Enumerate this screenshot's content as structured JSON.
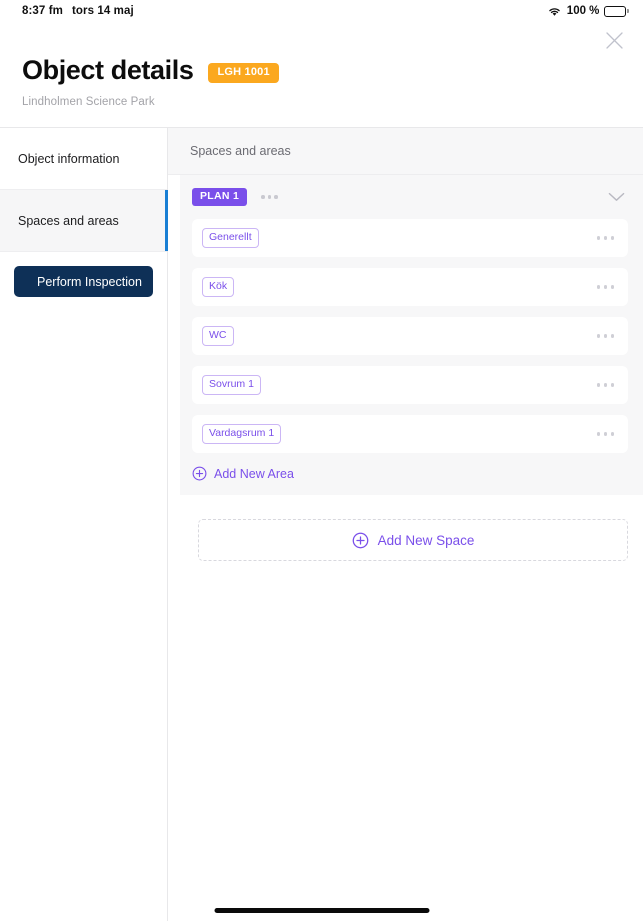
{
  "statusbar": {
    "time": "8:37 fm",
    "date": "tors 14 maj",
    "battery_percent": "100 %",
    "wifi_icon": "wifi-icon",
    "battery_icon": "battery-full-icon"
  },
  "header": {
    "close_icon": "close-icon",
    "title": "Object details",
    "object_badge": "LGH 1001",
    "subtitle": "Lindholmen Science Park"
  },
  "sidebar": {
    "items": [
      {
        "label": "Object information",
        "active": false
      },
      {
        "label": "Spaces and areas",
        "active": true
      }
    ],
    "inspect_button": {
      "label": "Perform Inspection",
      "icon": "scan-plus-icon"
    }
  },
  "main": {
    "section_title": "Spaces and areas",
    "plan": {
      "badge": "PLAN 1",
      "menu_icon": "ellipsis-icon",
      "collapse_icon": "chevron-down-icon",
      "areas": [
        {
          "label": "Generellt",
          "menu_icon": "ellipsis-icon"
        },
        {
          "label": "Kök",
          "menu_icon": "ellipsis-icon"
        },
        {
          "label": "WC",
          "menu_icon": "ellipsis-icon"
        },
        {
          "label": "Sovrum 1",
          "menu_icon": "ellipsis-icon"
        },
        {
          "label": "Vardagsrum 1",
          "menu_icon": "ellipsis-icon"
        }
      ],
      "add_area_label": "Add New Area",
      "add_area_icon": "plus-circle-icon"
    },
    "add_space_label": "Add New Space",
    "add_space_icon": "plus-circle-icon"
  },
  "colors": {
    "accent_purple": "#7A4FEA",
    "badge_orange": "#FBA81F",
    "navy_button": "#0E3057",
    "active_indicator_blue": "#1A7FD4",
    "panel_gray": "#F7F7F8"
  }
}
